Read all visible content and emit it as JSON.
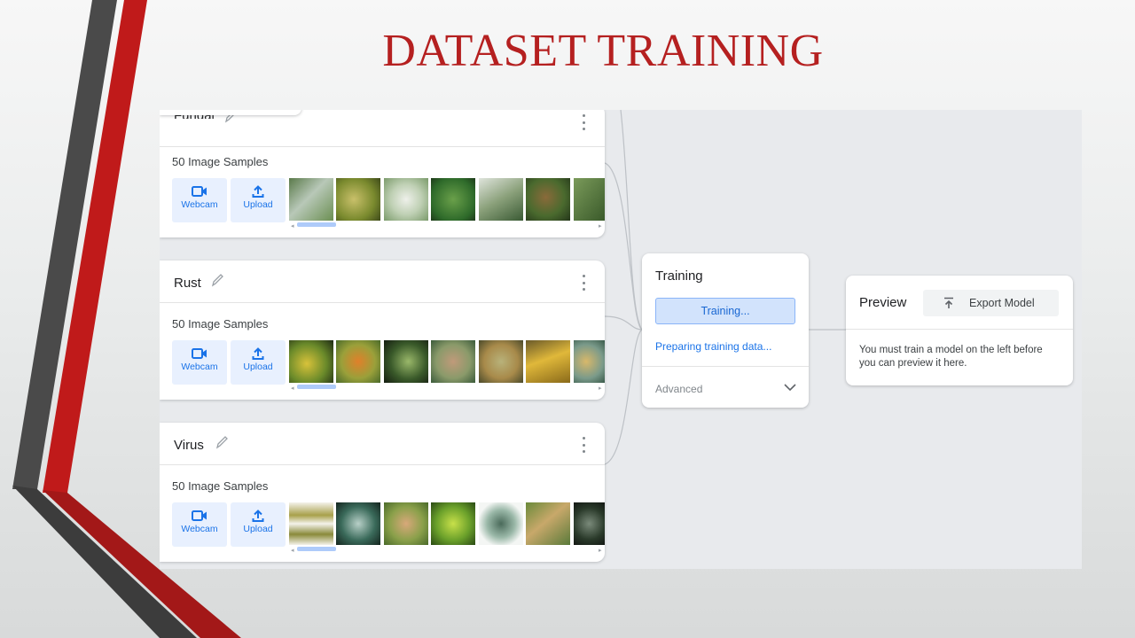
{
  "slide": {
    "title": "DATASET TRAINING"
  },
  "classes": [
    {
      "name": "Fungal",
      "samples": "50 Image Samples"
    },
    {
      "name": "Rust",
      "samples": "50 Image Samples"
    },
    {
      "name": "Virus",
      "samples": "50 Image Samples"
    }
  ],
  "buttons": {
    "webcam": "Webcam",
    "upload": "Upload"
  },
  "training": {
    "title": "Training",
    "button": "Training...",
    "status": "Preparing training data...",
    "advanced": "Advanced"
  },
  "preview": {
    "title": "Preview",
    "export": "Export Model",
    "message": "You must train a model on the left before you can preview it here."
  },
  "colors": {
    "title_red": "#b52020",
    "accent_blue": "#1a73e8",
    "button_blue_bg": "#e8f0fe",
    "deco_red": "#c01a1a",
    "deco_gray": "#4a4a4a"
  }
}
